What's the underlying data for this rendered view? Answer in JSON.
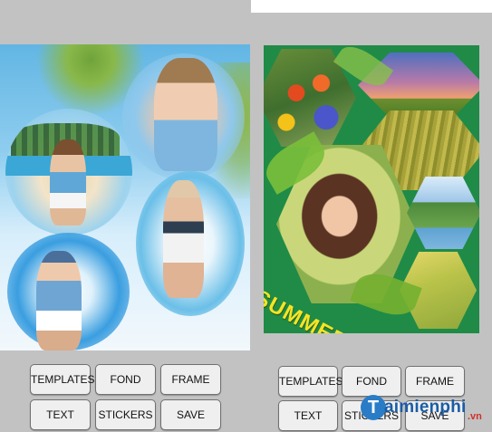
{
  "left_panel": {
    "buttons": {
      "templates": "TEMPLATES",
      "fond": "FOND",
      "frame": "FRAME",
      "text": "TEXT",
      "stickers": "STICKERS",
      "save": "SAVE"
    }
  },
  "right_panel": {
    "collage_caption": "SUMMER",
    "buttons": {
      "templates": "TEMPLATES",
      "fond": "FOND",
      "frame": "FRAME",
      "text": "TEXT",
      "stickers": "STICKERS",
      "save": "SAVE"
    }
  },
  "watermark": {
    "logo_letter": "T",
    "text": "aimienphi",
    "suffix": ".vn"
  },
  "colors": {
    "background": "#c2c2c2",
    "button_bg": "#efefef",
    "collage_green": "#1f8b47",
    "summer_text": "#f4e425",
    "watermark_blue": "#1a5da6"
  }
}
